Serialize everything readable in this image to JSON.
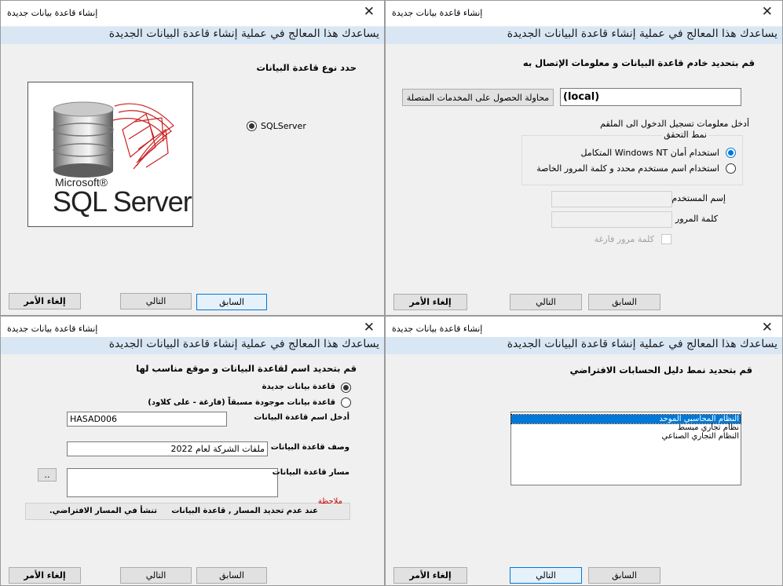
{
  "common": {
    "window_title": "إنشاء قاعدة بيانات جديدة",
    "banner": "يساعدك هذا المعالج في عملية إنشاء قاعدة البيانات الجديدة",
    "close_glyph": "✕",
    "back_label": "السابق",
    "next_label": "التالي",
    "cancel_label": "إلغاء الأمر"
  },
  "step1": {
    "heading": "حدد نوع قاعدة البيانات",
    "option_label": "SQLServer",
    "logo_ms": "Microsoft®",
    "logo_sql": "SQL Server",
    "logo_reg": "®"
  },
  "step2": {
    "heading": "قم بتحديد خادم قاعدة البيانات و معلومات الإتصال به",
    "get_services_label": "محاولة الحصول على المخدمات المتصلة",
    "server_value": "(local)",
    "login_info_label": "أدخل معلومات تسجيل الدخول الى الملقم",
    "auth_group_label": "نمط التحقق",
    "auth_windows_label": "استخدام أمان Windows NT المتكامل",
    "auth_sql_label": "استخدام اسم مستخدم محدد و كلمة المرور الخاصة",
    "username_label": "إسم المستخدم",
    "password_label": "كلمة المرور",
    "empty_password_label": "كلمة مرور فارغة"
  },
  "step3": {
    "heading": "قم بتحديد اسم لقاعدة البيانات و موقع مناسب لها",
    "new_db_label": "قاعدة بيانات جديدة",
    "existing_db_label": "قاعدة بيانات موجودة مسبقاً (فارغة - على كلاود)",
    "db_name_label": "أدخل اسم قاعدة البيانات",
    "db_name_value": "HASAD006",
    "db_desc_label": "وصف قاعدة البيانات",
    "db_desc_value": "ملفات الشركة لعام 2022",
    "db_path_label": "مسار قاعدة البيانات",
    "browse_label": "..",
    "note_title": "ملاحظة",
    "note_text_1": "عند عدم تحديد المسار , قاعدة البيانات",
    "note_text_2": "تنشأ في المسار الافتراضي."
  },
  "step4": {
    "heading": "قم بتحديد نمط دليل الحسابات الافتراضي",
    "chart_options": [
      "النظام المحاسبي الموحد",
      "نظام تجاري مبسط",
      "النظام التجاري الصناعي"
    ],
    "selected_index": 0
  },
  "colors": {
    "banner_bg": "#d9e7f5",
    "window_bg": "#f0f0f0",
    "selection": "#0078d7",
    "note_title": "#c00000"
  }
}
